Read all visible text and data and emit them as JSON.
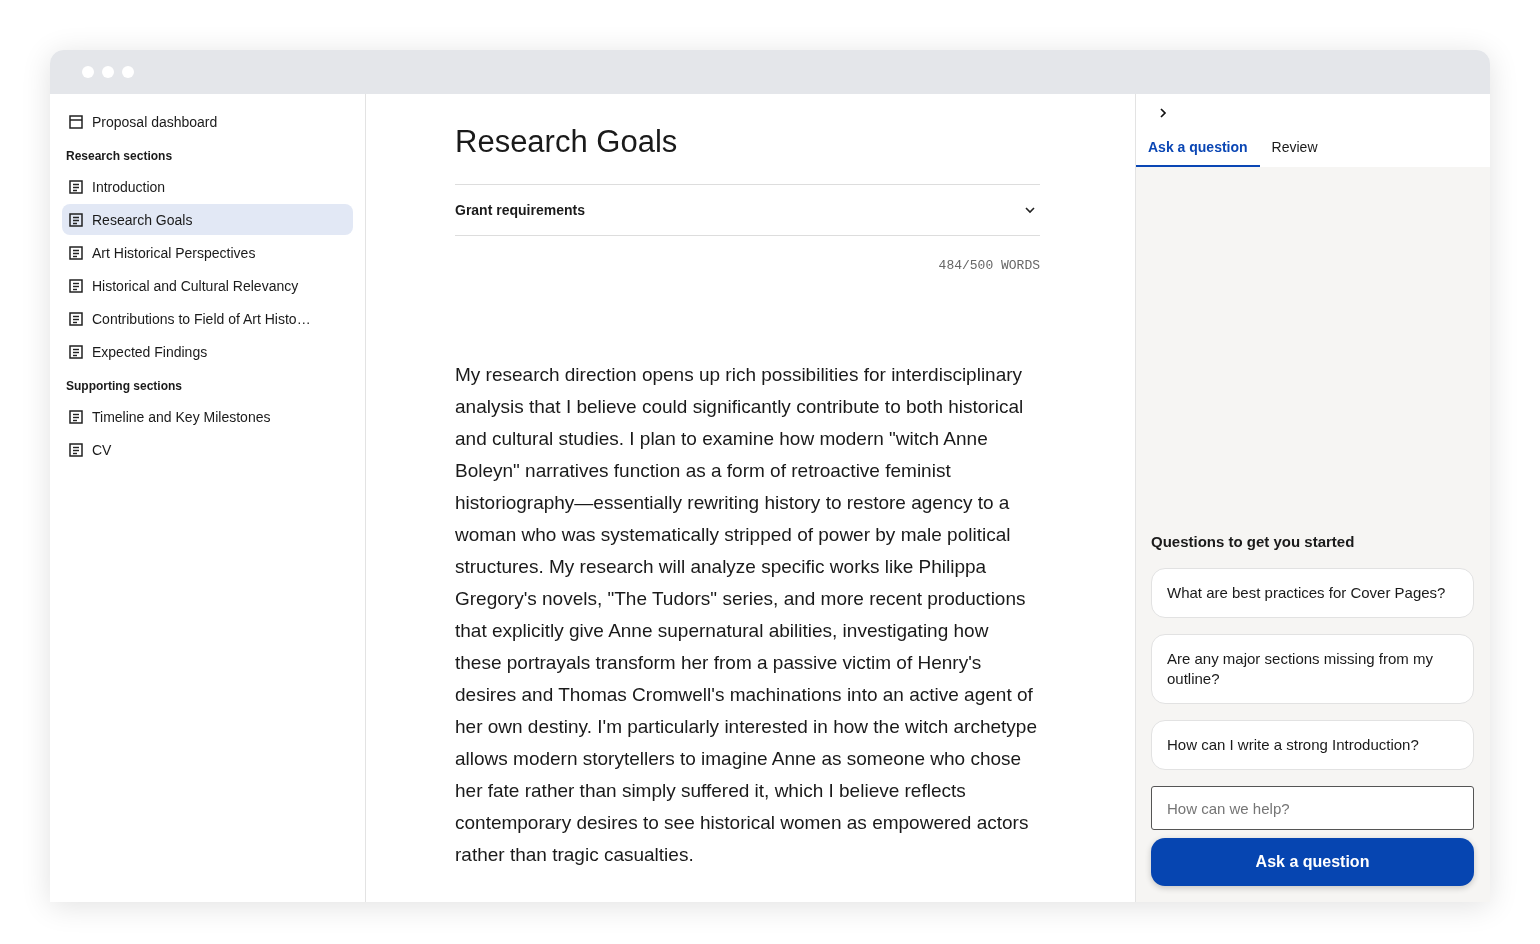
{
  "sidebar": {
    "top_item": {
      "label": "Proposal dashboard"
    },
    "groups": [
      {
        "heading": "Research sections",
        "items": [
          {
            "label": "Introduction",
            "selected": false
          },
          {
            "label": "Research Goals",
            "selected": true
          },
          {
            "label": "Art Historical Perspectives",
            "selected": false
          },
          {
            "label": "Historical and Cultural Relevancy",
            "selected": false
          },
          {
            "label": "Contributions to Field of Art Histo…",
            "selected": false
          },
          {
            "label": "Expected Findings",
            "selected": false
          }
        ]
      },
      {
        "heading": "Supporting sections",
        "items": [
          {
            "label": "Timeline and Key Milestones",
            "selected": false
          },
          {
            "label": "CV",
            "selected": false
          }
        ]
      }
    ]
  },
  "editor": {
    "title": "Research Goals",
    "accordion": {
      "label": "Grant requirements",
      "expanded": false
    },
    "word_count": "484/500 WORDS",
    "body": "My research direction opens up rich possibilities for interdisciplinary analysis that I believe could significantly contribute to both historical and cultural studies. I plan to examine how modern \"witch Anne Boleyn\" narratives function as a form of retroactive feminist historiography—essentially rewriting history to restore agency to a woman who was systematically stripped of power by male political structures. My research will analyze specific works like Philippa Gregory's novels, \"The Tudors\" series, and more recent productions that explicitly give Anne supernatural abilities, investigating how these portrayals transform her from a passive victim of Henry's desires and Thomas Cromwell's machinations into an active agent of her own destiny. I'm particularly interested in how the witch archetype allows modern storytellers to imagine Anne as someone who chose her fate rather than simply suffered it, which I believe reflects contemporary desires to see historical women as empowered actors rather than tragic casualties."
  },
  "assistant": {
    "tabs": [
      {
        "label": "Ask a question",
        "selected": true
      },
      {
        "label": "Review",
        "selected": false
      }
    ],
    "suggestions_heading": "Questions to get you started",
    "suggestions": [
      "What are best practices for Cover Pages?",
      "Are any major sections missing from my outline?",
      "How can I write a strong Introduction?"
    ],
    "input": {
      "placeholder": "How can we help?"
    },
    "submit": "Ask a question"
  }
}
